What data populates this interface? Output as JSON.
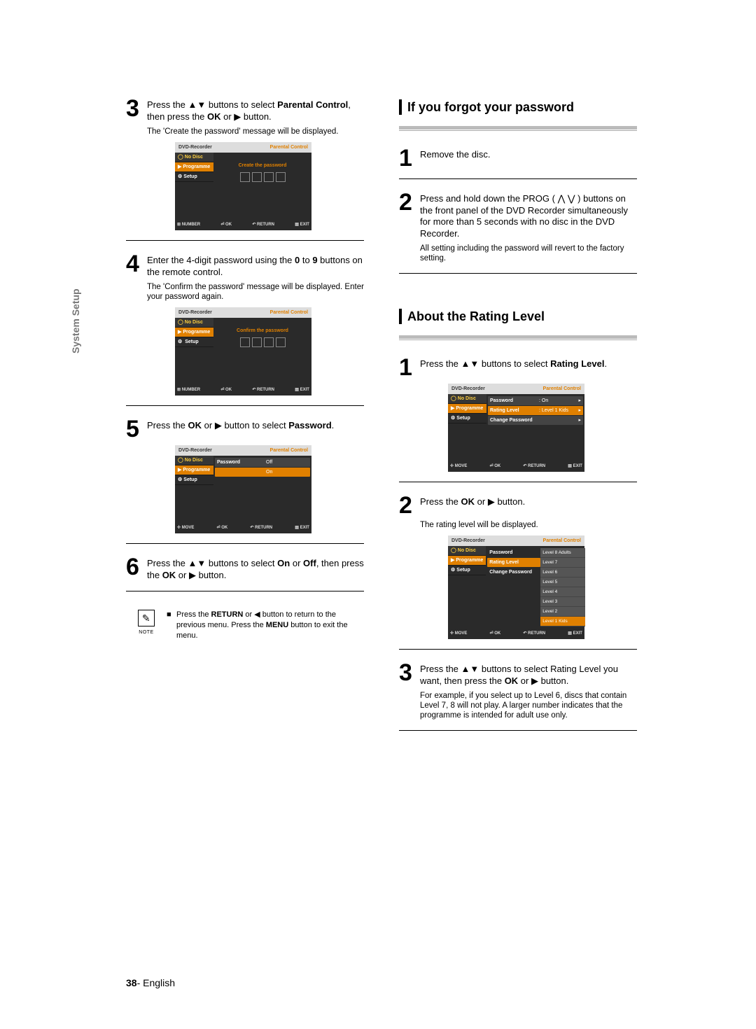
{
  "sideLabel": "System Setup",
  "footer": {
    "page": "38",
    "lang": "English"
  },
  "left": {
    "step3": {
      "text1": "Press the ",
      "text2": " buttons to select ",
      "bold1": "Parental Control",
      "text3": ", then press the ",
      "bold2": "OK",
      "text4": " or ",
      "text5": " button."
    },
    "step3sub": "The 'Create the password' message will be displayed.",
    "step4": {
      "text1": "Enter the 4-digit password using the ",
      "bold1": "0",
      "text2": " to ",
      "bold2": "9",
      "text3": " buttons on the remote control."
    },
    "step4sub": "The 'Confirm the password' message will be displayed. Enter your password again.",
    "step5": {
      "text1": "Press the ",
      "bold1": "OK",
      "text2": " or ",
      "text3": " button to select ",
      "bold2": "Password",
      "text4": "."
    },
    "step6": {
      "text1": "Press the ",
      "text2": " buttons to select ",
      "bold1": "On",
      "text3": " or ",
      "bold2": "Off",
      "text4": ", then press the ",
      "bold3": "OK",
      "text5": " or ",
      "text6": " button."
    },
    "note": {
      "label": "NOTE",
      "text1": "Press the ",
      "bold1": "RETURN",
      "text2": " or ",
      "text3": " button to return to the previous menu. Press the ",
      "bold2": "MENU",
      "text4": " button to exit the menu."
    }
  },
  "right": {
    "heading1": "If you forgot your password",
    "r1step1": "Remove the disc.",
    "r1step2": {
      "text1": "Press and hold down the PROG (",
      "text2": ") buttons on the front panel of the DVD Recorder simultaneously for more than 5 seconds with no disc in the DVD Recorder."
    },
    "r1step2sub": "All setting including the password will revert to the factory setting.",
    "heading2": "About the Rating Level",
    "r2step1": {
      "text1": "Press the ",
      "text2": " buttons to select ",
      "bold1": "Rating Level",
      "text3": "."
    },
    "r2step2": {
      "text1": "Press the ",
      "bold1": "OK",
      "text2": " or ",
      "text3": " button."
    },
    "r2step2sub": "The rating level will be displayed.",
    "r2step3": {
      "text1": "Press the ",
      "text2": " buttons to select Rating Level you want, then press the ",
      "bold1": "OK",
      "text3": " or ",
      "text4": " button."
    },
    "r2step3sub": "For example, if you select up to Level 6, discs that contain Level 7, 8 will not play. A larger number indicates that the programme is intended for adult use only."
  },
  "osd": {
    "recorder": "DVD-Recorder",
    "pc": "Parental Control",
    "noDisc": "No Disc",
    "programme": "Programme",
    "setup": "Setup",
    "create": "Create the password",
    "confirm": "Confirm the password",
    "password": "Password",
    "off": "Off",
    "on": "On",
    "ratingLevel": "Rating Level",
    "level1kids": "Level 1 Kids",
    "changePassword": "Change Password",
    "levels": [
      "Level 8 Adults",
      "Level 7",
      "Level 6",
      "Level 5",
      "Level 4",
      "Level 3",
      "Level 2",
      "Level 1 Kids"
    ],
    "foot": {
      "number": "NUMBER",
      "move": "MOVE",
      "ok": "OK",
      "return": "RETURN",
      "exit": "EXIT"
    }
  }
}
